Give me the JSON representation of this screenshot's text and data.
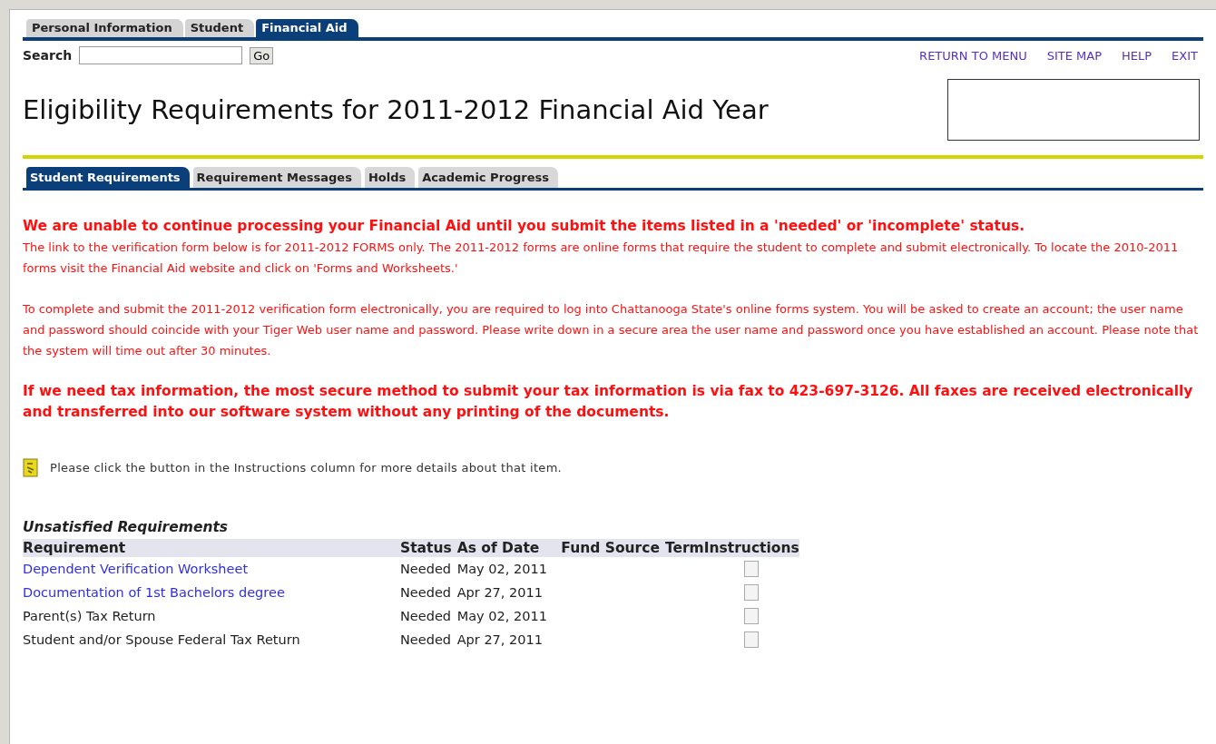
{
  "main_tabs": [
    {
      "label": "Personal Information",
      "selected": false
    },
    {
      "label": "Student",
      "selected": false
    },
    {
      "label": "Financial Aid",
      "selected": true
    }
  ],
  "search": {
    "label": "Search",
    "button": "Go"
  },
  "nav_links": [
    "RETURN TO MENU",
    "SITE MAP",
    "HELP",
    "EXIT"
  ],
  "page_title": "Eligibility Requirements for 2011-2012 Financial Aid Year",
  "sub_tabs": [
    {
      "label": "Student Requirements",
      "selected": true
    },
    {
      "label": "Requirement Messages",
      "selected": false
    },
    {
      "label": "Holds",
      "selected": false
    },
    {
      "label": "Academic Progress",
      "selected": false
    }
  ],
  "messages": [
    {
      "kind": "bold",
      "text": "We are unable to continue processing your Financial Aid until you submit the items listed in a 'needed' or 'incomplete' status."
    },
    {
      "kind": "plain",
      "text": "The link to the verification form below is for 2011-2012 FORMS only. The 2011-2012 forms are online forms that require the student to complete and submit electronically. To locate the 2010-2011 forms visit the Financial Aid website and click on 'Forms and Worksheets.'"
    },
    {
      "kind": "plain",
      "text": "To complete and submit the 2011-2012 verification form electronically, you are required to log into Chattanooga State's online forms system. You will be asked to create an account; the user name and password should coincide with your Tiger Web user name and password. Please write down in a secure area the user name and password once you have established an account. Please note that the system will time out after 30 minutes."
    },
    {
      "kind": "bold",
      "text": "If we need tax information, the most secure method to submit your tax information is via fax to 423-697-3126. All faxes are received electronically and transferred into our software system without any printing of the documents."
    }
  ],
  "info_note": "Please click the button in the Instructions column for more details about that item.",
  "table": {
    "caption": "Unsatisfied Requirements",
    "columns": [
      "Requirement",
      "Status",
      "As of Date",
      "Fund Source",
      "Term",
      "Instructions"
    ],
    "rows": [
      {
        "requirement": "Dependent Verification Worksheet",
        "kind": "link",
        "status": "Needed",
        "date": "May 02, 2011"
      },
      {
        "requirement": "Documentation of 1st Bachelors degree",
        "kind": "link",
        "status": "Needed",
        "date": "Apr 27, 2011"
      },
      {
        "requirement": "Parent(s) Tax Return",
        "kind": "text",
        "status": "Needed",
        "date": "May 02, 2011"
      },
      {
        "requirement": "Student and/or Spouse Federal Tax Return",
        "kind": "text",
        "status": "Needed",
        "date": "Apr 27, 2011"
      }
    ]
  }
}
